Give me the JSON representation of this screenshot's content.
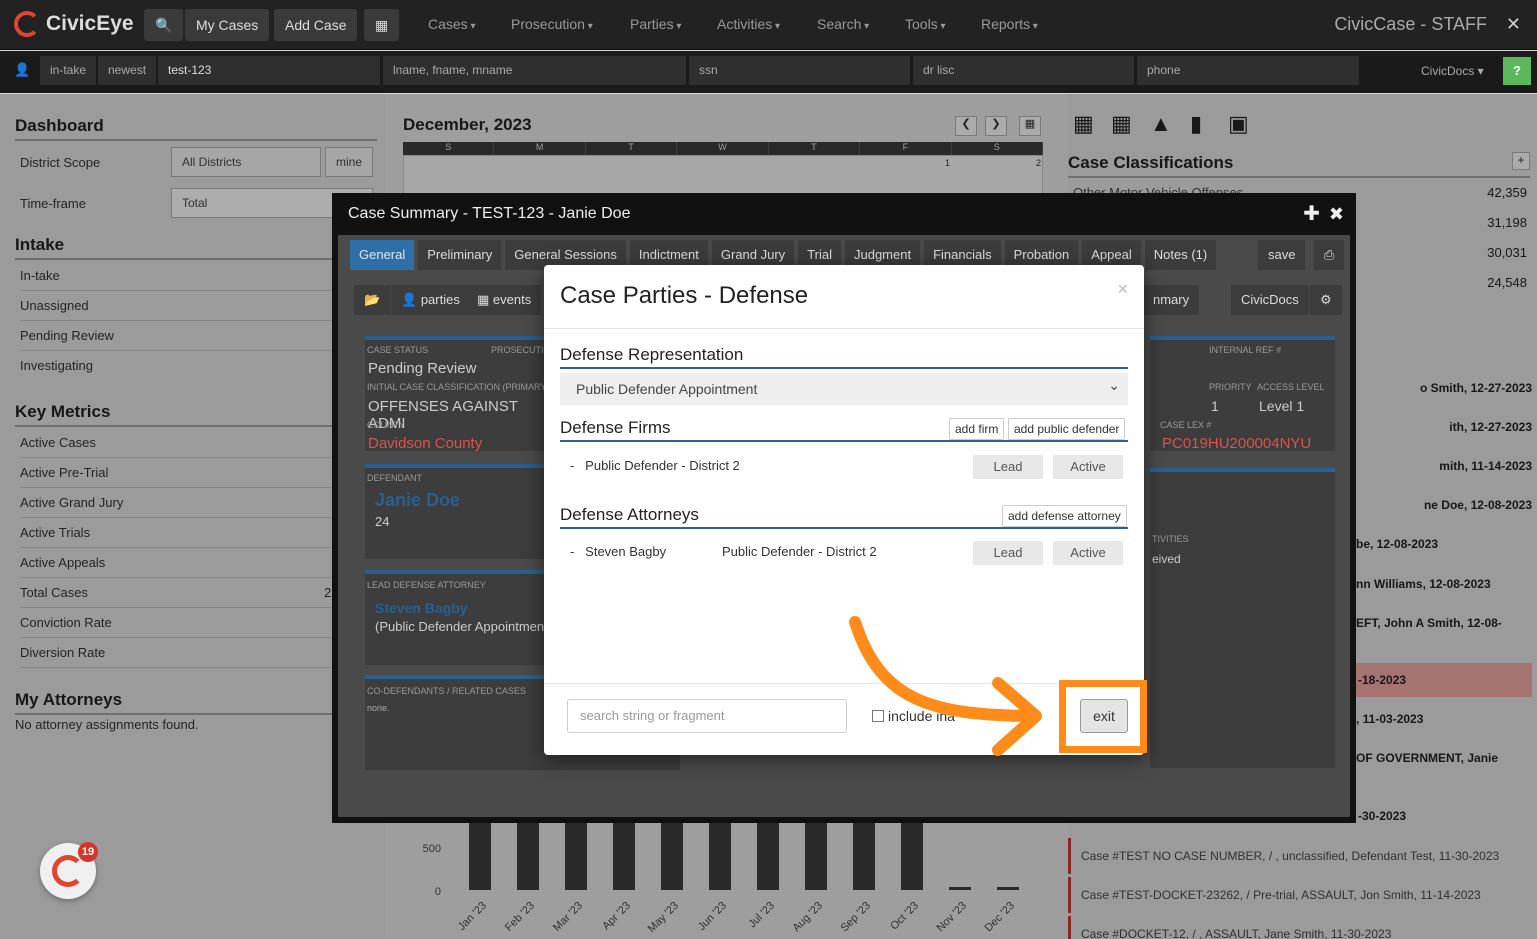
{
  "nav": {
    "brand": "CivicEye",
    "my_cases": "My Cases",
    "add_case": "Add Case",
    "menus": [
      "Cases",
      "Prosecution",
      "Parties",
      "Activities",
      "Search",
      "Tools",
      "Reports"
    ],
    "staff": "CivicCase - STAFF",
    "close": "✕"
  },
  "subbar": {
    "intake": "in-take",
    "newest": "newest",
    "case_search_value": "test-123",
    "name_placeholder": "lname, fname, mname",
    "ssn_placeholder": "ssn",
    "dl_placeholder": "dr lisc",
    "phone_placeholder": "phone",
    "civicdocs": "CivicDocs",
    "help": "?"
  },
  "dashboard": {
    "title": "Dashboard",
    "district_scope_label": "District Scope",
    "district_scope_value": "All Districts",
    "mine": "mine",
    "timeframe_label": "Time-frame",
    "timeframe_value": "Total"
  },
  "intake": {
    "title": "Intake",
    "items": [
      "In-take",
      "Unassigned",
      "Pending Review",
      "Investigating"
    ]
  },
  "metrics": {
    "title": "Key Metrics",
    "items": [
      "Active Cases",
      "Active Pre-Trial",
      "Active Grand Jury",
      "Active Trials",
      "Active Appeals",
      "Total Cases",
      "Conviction Rate",
      "Diversion Rate"
    ],
    "total_partial": "2"
  },
  "attorneys": {
    "title": "My Attorneys",
    "empty": "No attorney assignments found."
  },
  "calendar": {
    "title": "December, 2023",
    "days": [
      "S",
      "M",
      "T",
      "W",
      "T",
      "F",
      "S"
    ],
    "d1": "1",
    "d2": "2"
  },
  "classifications": {
    "title": "Case Classifications",
    "plus": "+",
    "first_label": "Other Motor Vehicle Offenses",
    "counts": [
      "42,359",
      "31,198",
      "30,031",
      "24,548"
    ]
  },
  "recent": [
    "o Smith, 12-27-2023",
    "ith, 12-27-2023",
    "mith, 11-14-2023",
    "ne Doe, 12-08-2023",
    "be, 12-08-2023",
    "nn Williams, 12-08-2023",
    "EFT, John A Smith, 12-08-",
    "-18-2023",
    ", 11-03-2023",
    "OF GOVERNMENT, Janie",
    "-30-2023"
  ],
  "bottom_cases": [
    "Case #TEST NO CASE NUMBER, / , unclassified, Defendant Test, 11-30-2023",
    "Case #TEST-DOCKET-23262, / Pre-trial, ASSAULT, Jon Smith, 11-14-2023",
    "Case #DOCKET-12, / , ASSAULT, Jane Smith, 11-30-2023"
  ],
  "chart_data": {
    "type": "bar",
    "categories": [
      "Jan '23",
      "Feb '23",
      "Mar '23",
      "Apr '23",
      "May '23",
      "Jun '23",
      "Jul '23",
      "Aug '23",
      "Sep '23",
      "Oct '23",
      "Nov '23",
      "Dec '23"
    ],
    "y_ticks": [
      "500",
      "0"
    ]
  },
  "modal": {
    "title": "Case Summary - TEST-123 - Janie Doe",
    "tabs": [
      "General",
      "Preliminary",
      "General Sessions",
      "Indictment",
      "Grand Jury",
      "Trial",
      "Judgment",
      "Financials",
      "Probation",
      "Appeal",
      "Notes (1)"
    ],
    "save": "save",
    "parties": "parties",
    "events": "events",
    "summary_partial": "nmary",
    "civicdocs": "CivicDocs",
    "case_status_label": "CASE STATUS",
    "case_status": "Pending Review",
    "prosecution_label": "PROSECUTI",
    "initial_class_label": "INITIAL CASE CLASSIFICATION (PRIMARY",
    "initial_class": "OFFENSES AGAINST ADMI",
    "county_label": "COUNTY",
    "county": "Davidson County",
    "internal_ref_label": "INTERNAL REF #",
    "priority_label": "PRIORITY",
    "priority": "1",
    "access_label": "ACCESS LEVEL",
    "access": "Level 1",
    "lex_label": "CASE LEX #",
    "lex": "PC019HU200004NYU",
    "defendant_label": "DEFENDANT",
    "defendant": "Janie Doe",
    "defendant_age": "24",
    "activities_label": "TIVITIES",
    "activities_val": "eived",
    "lead_attorney_label": "LEAD DEFENSE ATTORNEY",
    "lead_attorney": "Steven Bagby",
    "lead_attorney_type": "(Public Defender Appointmen",
    "codef_label": "CO-DEFENDANTS / RELATED CASES",
    "codef": "none."
  },
  "dialog": {
    "title": "Case Parties - Defense",
    "close": "×",
    "rep_heading": "Defense Representation",
    "rep_value": "Public Defender Appointment",
    "firms_heading": "Defense Firms",
    "add_firm": "add firm",
    "add_pd": "add public defender",
    "firm_name": "Public Defender - District 2",
    "lead": "Lead",
    "active": "Active",
    "att_heading": "Defense Attorneys",
    "add_att": "add defense attorney",
    "att_name": "Steven Bagby",
    "att_firm": "Public Defender - District 2",
    "search_placeholder": "search string or fragment",
    "include": "include ina",
    "exit": "exit"
  },
  "notif": {
    "count": "19"
  }
}
